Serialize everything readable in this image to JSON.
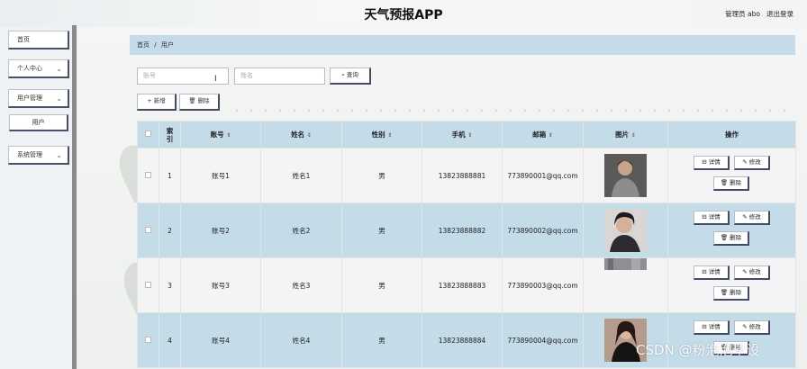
{
  "app": {
    "title": "天气预报APP"
  },
  "header": {
    "user_label": "管理员 abo",
    "logout_label": "退出登录"
  },
  "sidebar": {
    "items": [
      {
        "label": "首页"
      },
      {
        "label": "个人中心",
        "chevron": "chevron-down-icon"
      },
      {
        "label": "用户管理",
        "chevron": "chevron-down-icon"
      },
      {
        "label": "系统管理",
        "chevron": "chevron-down-icon"
      }
    ],
    "sub_items": [
      {
        "label": "用户"
      }
    ]
  },
  "breadcrumb": {
    "home": "首页",
    "sep": "/",
    "current": "用户"
  },
  "search": {
    "account_placeholder": "账号",
    "name_placeholder": "姓名",
    "query_label": "查询",
    "query_icon": "search-icon"
  },
  "toolbar": {
    "add_label": "新增",
    "add_icon": "plus-icon",
    "delete_label": "删除",
    "delete_icon": "trash-icon"
  },
  "table": {
    "columns": [
      "",
      "索引",
      "账号",
      "姓名",
      "性别",
      "手机",
      "邮箱",
      "图片",
      "操作"
    ],
    "rows": [
      {
        "index": "1",
        "account": "账号1",
        "name": "姓名1",
        "gender": "男",
        "phone": "13823888881",
        "email": "773890001@qq.com"
      },
      {
        "index": "2",
        "account": "账号2",
        "name": "姓名2",
        "gender": "男",
        "phone": "13823888882",
        "email": "773890002@qq.com"
      },
      {
        "index": "3",
        "account": "账号3",
        "name": "姓名3",
        "gender": "男",
        "phone": "13823888883",
        "email": "773890003@qq.com"
      },
      {
        "index": "4",
        "account": "账号4",
        "name": "姓名4",
        "gender": "男",
        "phone": "13823888884",
        "email": "773890004@qq.com"
      }
    ],
    "actions": {
      "detail": "详情",
      "edit": "修改",
      "delete": "删除"
    }
  },
  "watermark": "CSDN @粉泡泡毕设"
}
